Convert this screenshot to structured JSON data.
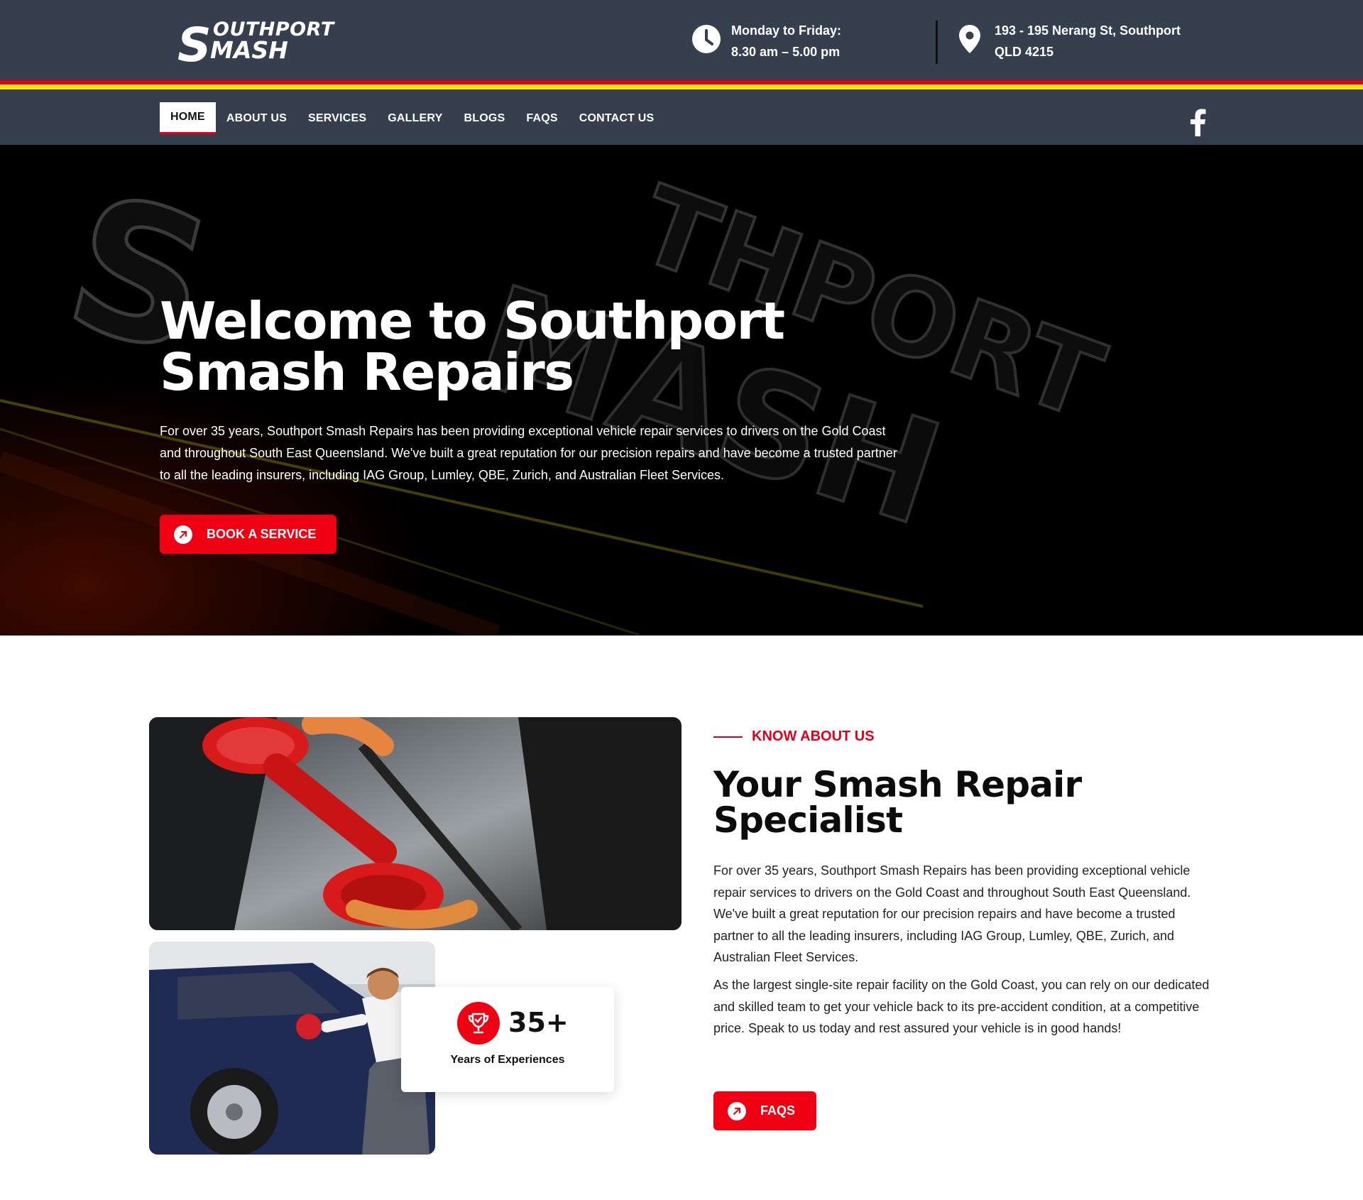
{
  "header": {
    "logo_alt": "Southport Smash",
    "logo_line1": "OUTHPORT",
    "logo_line2": "MASH",
    "logo_letter": "S",
    "hours_line1": "Monday to Friday:",
    "hours_line2": "8.30 am – 5.00 pm",
    "address_line1": "193 - 195 Nerang St, Southport",
    "address_line2": "QLD 4215"
  },
  "nav": {
    "items": [
      {
        "label": "HOME"
      },
      {
        "label": "ABOUT US"
      },
      {
        "label": "SERVICES"
      },
      {
        "label": "GALLERY"
      },
      {
        "label": "BLOGS"
      },
      {
        "label": "FAQS"
      },
      {
        "label": "CONTACT US"
      }
    ],
    "active": "HOME"
  },
  "hero": {
    "title": "Welcome to Southport Smash Repairs",
    "body": "For over 35 years, Southport Smash Repairs has been providing exceptional vehicle repair services to drivers on the Gold Coast and throughout South East Queensland. We've built a great reputation for our precision repairs and have become a trusted partner to all the leading insurers, including IAG Group, Lumley, QBE, Zurich, and Australian Fleet Services.",
    "cta_label": "BOOK A SERVICE",
    "sign_text": "SOUTHPORT SMASH"
  },
  "about": {
    "eyebrow": "KNOW ABOUT US",
    "title": "Your Smash Repair Specialist",
    "paragraph1": "For over 35 years, Southport Smash Repairs has been providing exceptional vehicle repair services to drivers on the Gold Coast and throughout South East Queensland. We've built a great reputation for our precision repairs and have become a trusted partner to all the leading insurers, including IAG Group, Lumley, QBE, Zurich, and Australian Fleet Services.",
    "paragraph2": "As the largest single-site repair facility on the Gold Coast, you can rely on our dedicated and skilled team to get your vehicle back to its pre-accident condition, at a competitive price. Speak to us today and rest assured your vehicle is in good hands!",
    "stat_number": "35+",
    "stat_label": "Years of Experiences",
    "cta_label": "FAQS"
  },
  "colors": {
    "header_bg": "#363f4e",
    "accent_red": "#f00012",
    "stripe_red": "#e1001b",
    "stripe_yellow": "#f7e80d"
  },
  "icons": [
    "clock-icon",
    "location-pin-icon",
    "facebook-icon",
    "arrow-up-right-icon",
    "trophy-icon"
  ]
}
